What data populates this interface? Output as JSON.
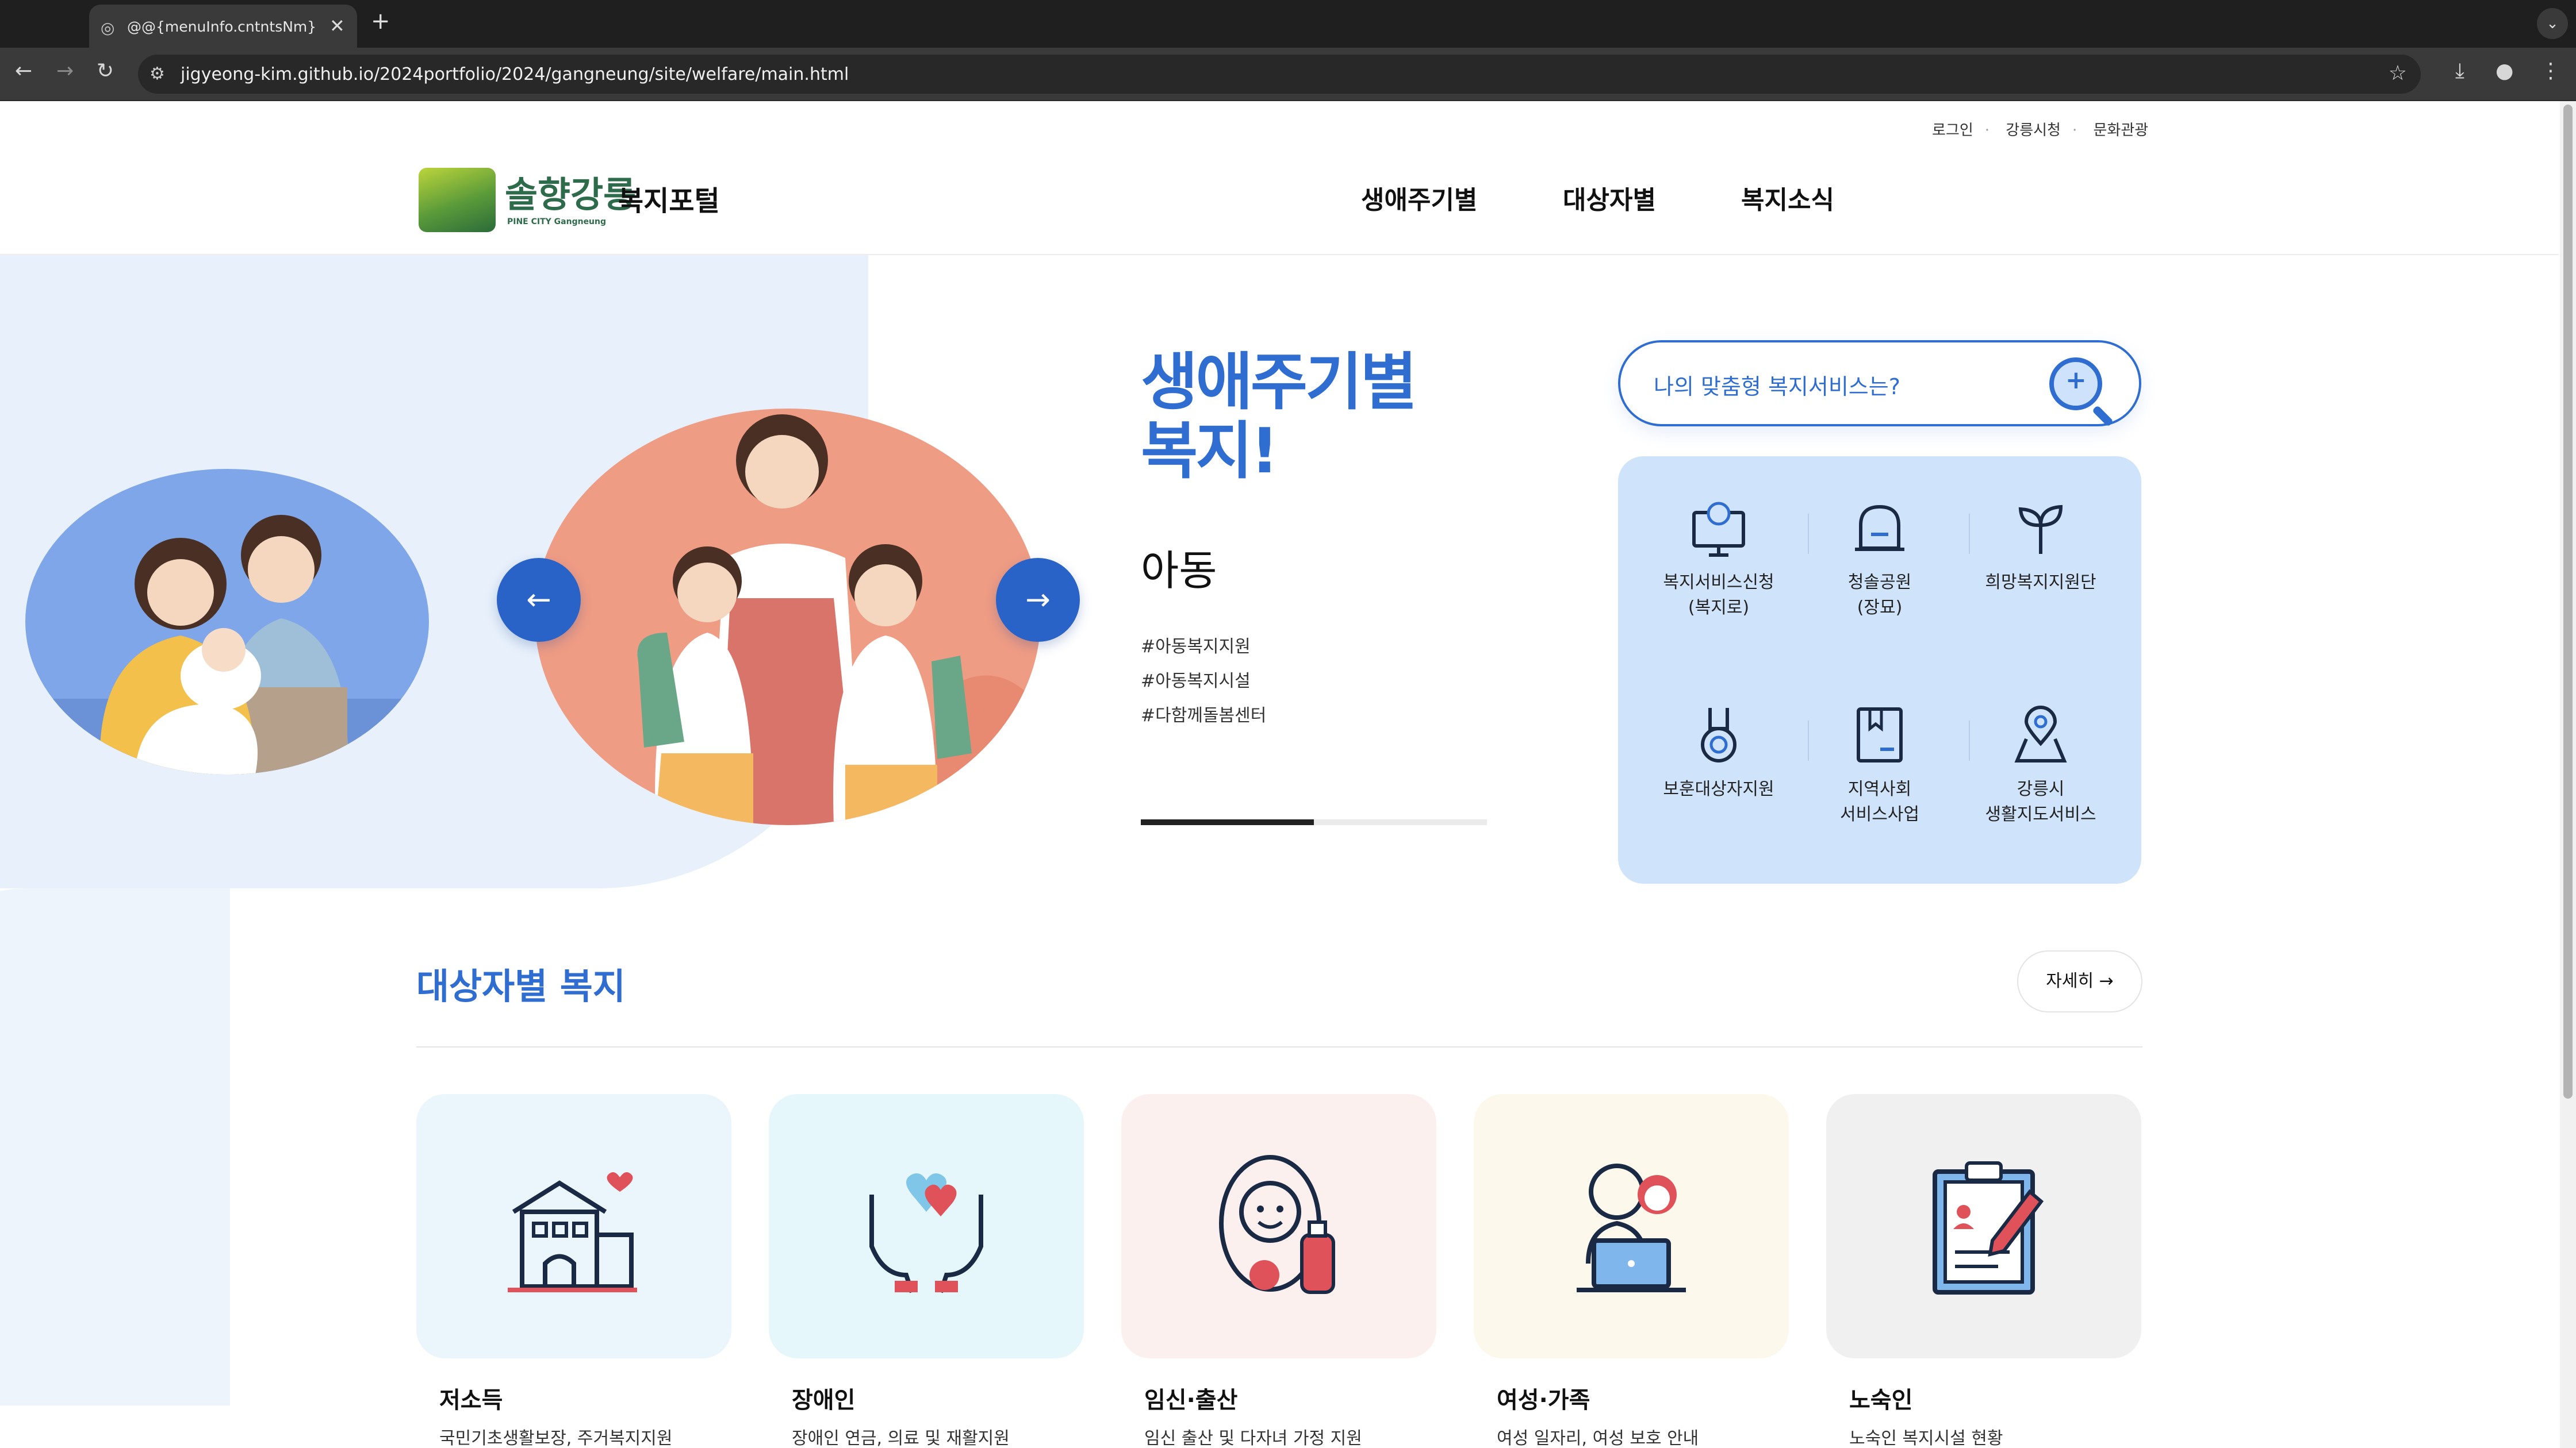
{
  "browser": {
    "tab_title": "@@{menuInfo.cntntsNm} - @",
    "url": "jigyeong-kim.github.io/2024portfolio/2024/gangneung/site/welfare/main.html"
  },
  "util_links": [
    "로그인",
    "강릉시청",
    "문화관광"
  ],
  "logo": {
    "word": "솔향강릉",
    "sub": "PINE CITY Gangneung"
  },
  "site_name": "복지포털",
  "nav": [
    "생애주기별",
    "대상자별",
    "복지소식"
  ],
  "hero": {
    "title_line1": "생애주기별",
    "title_line2": "복지!",
    "subtitle": "아동",
    "tags": [
      "#아동복지지원",
      "#아동복지시설",
      "#다함께돌봄센터"
    ],
    "progress": 0.5,
    "prev_label": "←",
    "next_label": "→"
  },
  "search": {
    "placeholder": "나의 맞춤형 복지서비스는?"
  },
  "quick_links": [
    {
      "label": "복지서비스신청\n(복지로)",
      "icon": "monitor-globe-icon"
    },
    {
      "label": "청솔공원\n(장묘)",
      "icon": "memorial-icon"
    },
    {
      "label": "희망복지지원단",
      "icon": "sprout-icon"
    },
    {
      "label": "보훈대상자지원",
      "icon": "medal-icon"
    },
    {
      "label": "지역사회\n서비스사업",
      "icon": "book-icon"
    },
    {
      "label": "강릉시\n생활지도서비스",
      "icon": "location-pin-icon"
    }
  ],
  "section": {
    "title": "대상자별 복지",
    "more_label": "자세히"
  },
  "cards": [
    {
      "label": "저소득",
      "desc": "국민기초생활보장, 주거복지지원",
      "bg": "#eaf5fc",
      "icon": "house-icon"
    },
    {
      "label": "장애인",
      "desc": "장애인 연금, 의료 및 재활지원",
      "bg": "#e6f7fb",
      "icon": "hands-heart-icon"
    },
    {
      "label": "임신·출산",
      "desc": "임신 출산 및 다자녀 가정 지원",
      "bg": "#fcf0ef",
      "icon": "baby-bottle-icon"
    },
    {
      "label": "여성·가족",
      "desc": "여성 일자리, 여성 보호 안내",
      "bg": "#fcf8ec",
      "icon": "women-laptop-icon"
    },
    {
      "label": "노숙인",
      "desc": "노숙인 복지시설 현황",
      "bg": "#f0f0f0",
      "icon": "clipboard-icon"
    }
  ]
}
